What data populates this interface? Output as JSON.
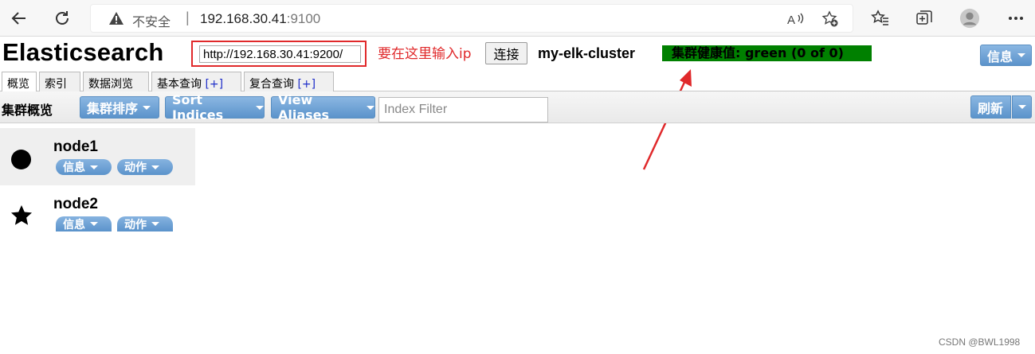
{
  "browser": {
    "insecure_label": "不安全",
    "separator": "|",
    "url_host": "192.168.30.41",
    "url_port": ":9100"
  },
  "app": {
    "title": "Elasticsearch",
    "connect_url": "http://192.168.30.41:9200/",
    "annotation": "要在这里输入ip",
    "connect_label": "连接",
    "cluster_name": "my-elk-cluster",
    "health": "集群健康值: green (0 of 0)",
    "info_label": "信息"
  },
  "tabs": [
    {
      "label": "概览",
      "plus": ""
    },
    {
      "label": "索引",
      "plus": ""
    },
    {
      "label": "数据浏览",
      "plus": ""
    },
    {
      "label": "基本查询",
      "plus": "[+]"
    },
    {
      "label": "复合查询",
      "plus": "[+]"
    }
  ],
  "toolbar": {
    "title": "集群概览",
    "sort_cluster": "集群排序",
    "sort_indices": "Sort Indices",
    "view_aliases": "View Aliases",
    "index_filter_placeholder": "Index Filter",
    "refresh": "刷新"
  },
  "nodes": [
    {
      "name": "node1",
      "info": "信息",
      "actions": "动作",
      "icon": "circle-icon"
    },
    {
      "name": "node2",
      "info": "信息",
      "actions": "动作",
      "icon": "star-icon"
    }
  ],
  "watermark": "CSDN @BWL1998",
  "colors": {
    "health": "#008000",
    "annotation": "#e0292b",
    "button": "#5b93cb"
  }
}
